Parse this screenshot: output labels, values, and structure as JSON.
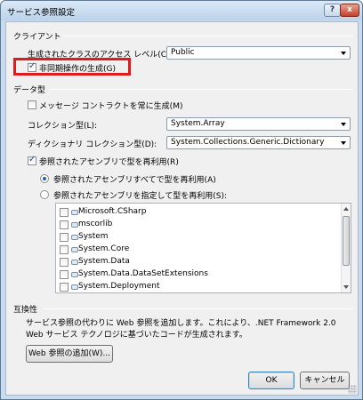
{
  "window": {
    "title": "サービス参照設定",
    "help_glyph": "?",
    "close_glyph": "x"
  },
  "client_section": {
    "header": "クライアント",
    "access_level_label": "生成されたクラスのアクセス レベル(C):",
    "access_level_value": "Public",
    "async_label": "非同期操作の生成(G)",
    "async_checked": true
  },
  "data_section": {
    "header": "データ型",
    "always_generate_label": "メッセージ コントラクトを常に生成(M)",
    "always_generate_checked": false,
    "collection_label": "コレクション型(L):",
    "collection_value": "System.Array",
    "dictionary_label": "ディクショナリ コレクション型(D):",
    "dictionary_value": "System.Collections.Generic.Dictionary",
    "reuse_label": "参照されたアセンブリで型を再利用(R)",
    "reuse_checked": true,
    "reuse_all_label": "参照されたアセンブリすべてで型を再利用(A)",
    "reuse_specified_label": "参照されたアセンブリを指定して型を再利用(S):",
    "assemblies": [
      {
        "name": "Microsoft.CSharp",
        "checked": false
      },
      {
        "name": "mscorlib",
        "checked": false
      },
      {
        "name": "System",
        "checked": false
      },
      {
        "name": "System.Core",
        "checked": false
      },
      {
        "name": "System.Data",
        "checked": false
      },
      {
        "name": "System.Data.DataSetExtensions",
        "checked": false
      },
      {
        "name": "System.Deployment",
        "checked": false
      }
    ]
  },
  "compat_section": {
    "header": "互換性",
    "description": "サービス参照の代わりに Web 参照を追加します。これにより、.NET Framework 2.0 Web サービス テクノロジに基づいたコードが生成されます。",
    "add_web_ref_button": "Web 参照の追加(W)..."
  },
  "footer": {
    "ok_button": "OK",
    "cancel_button": "キャンセル"
  }
}
